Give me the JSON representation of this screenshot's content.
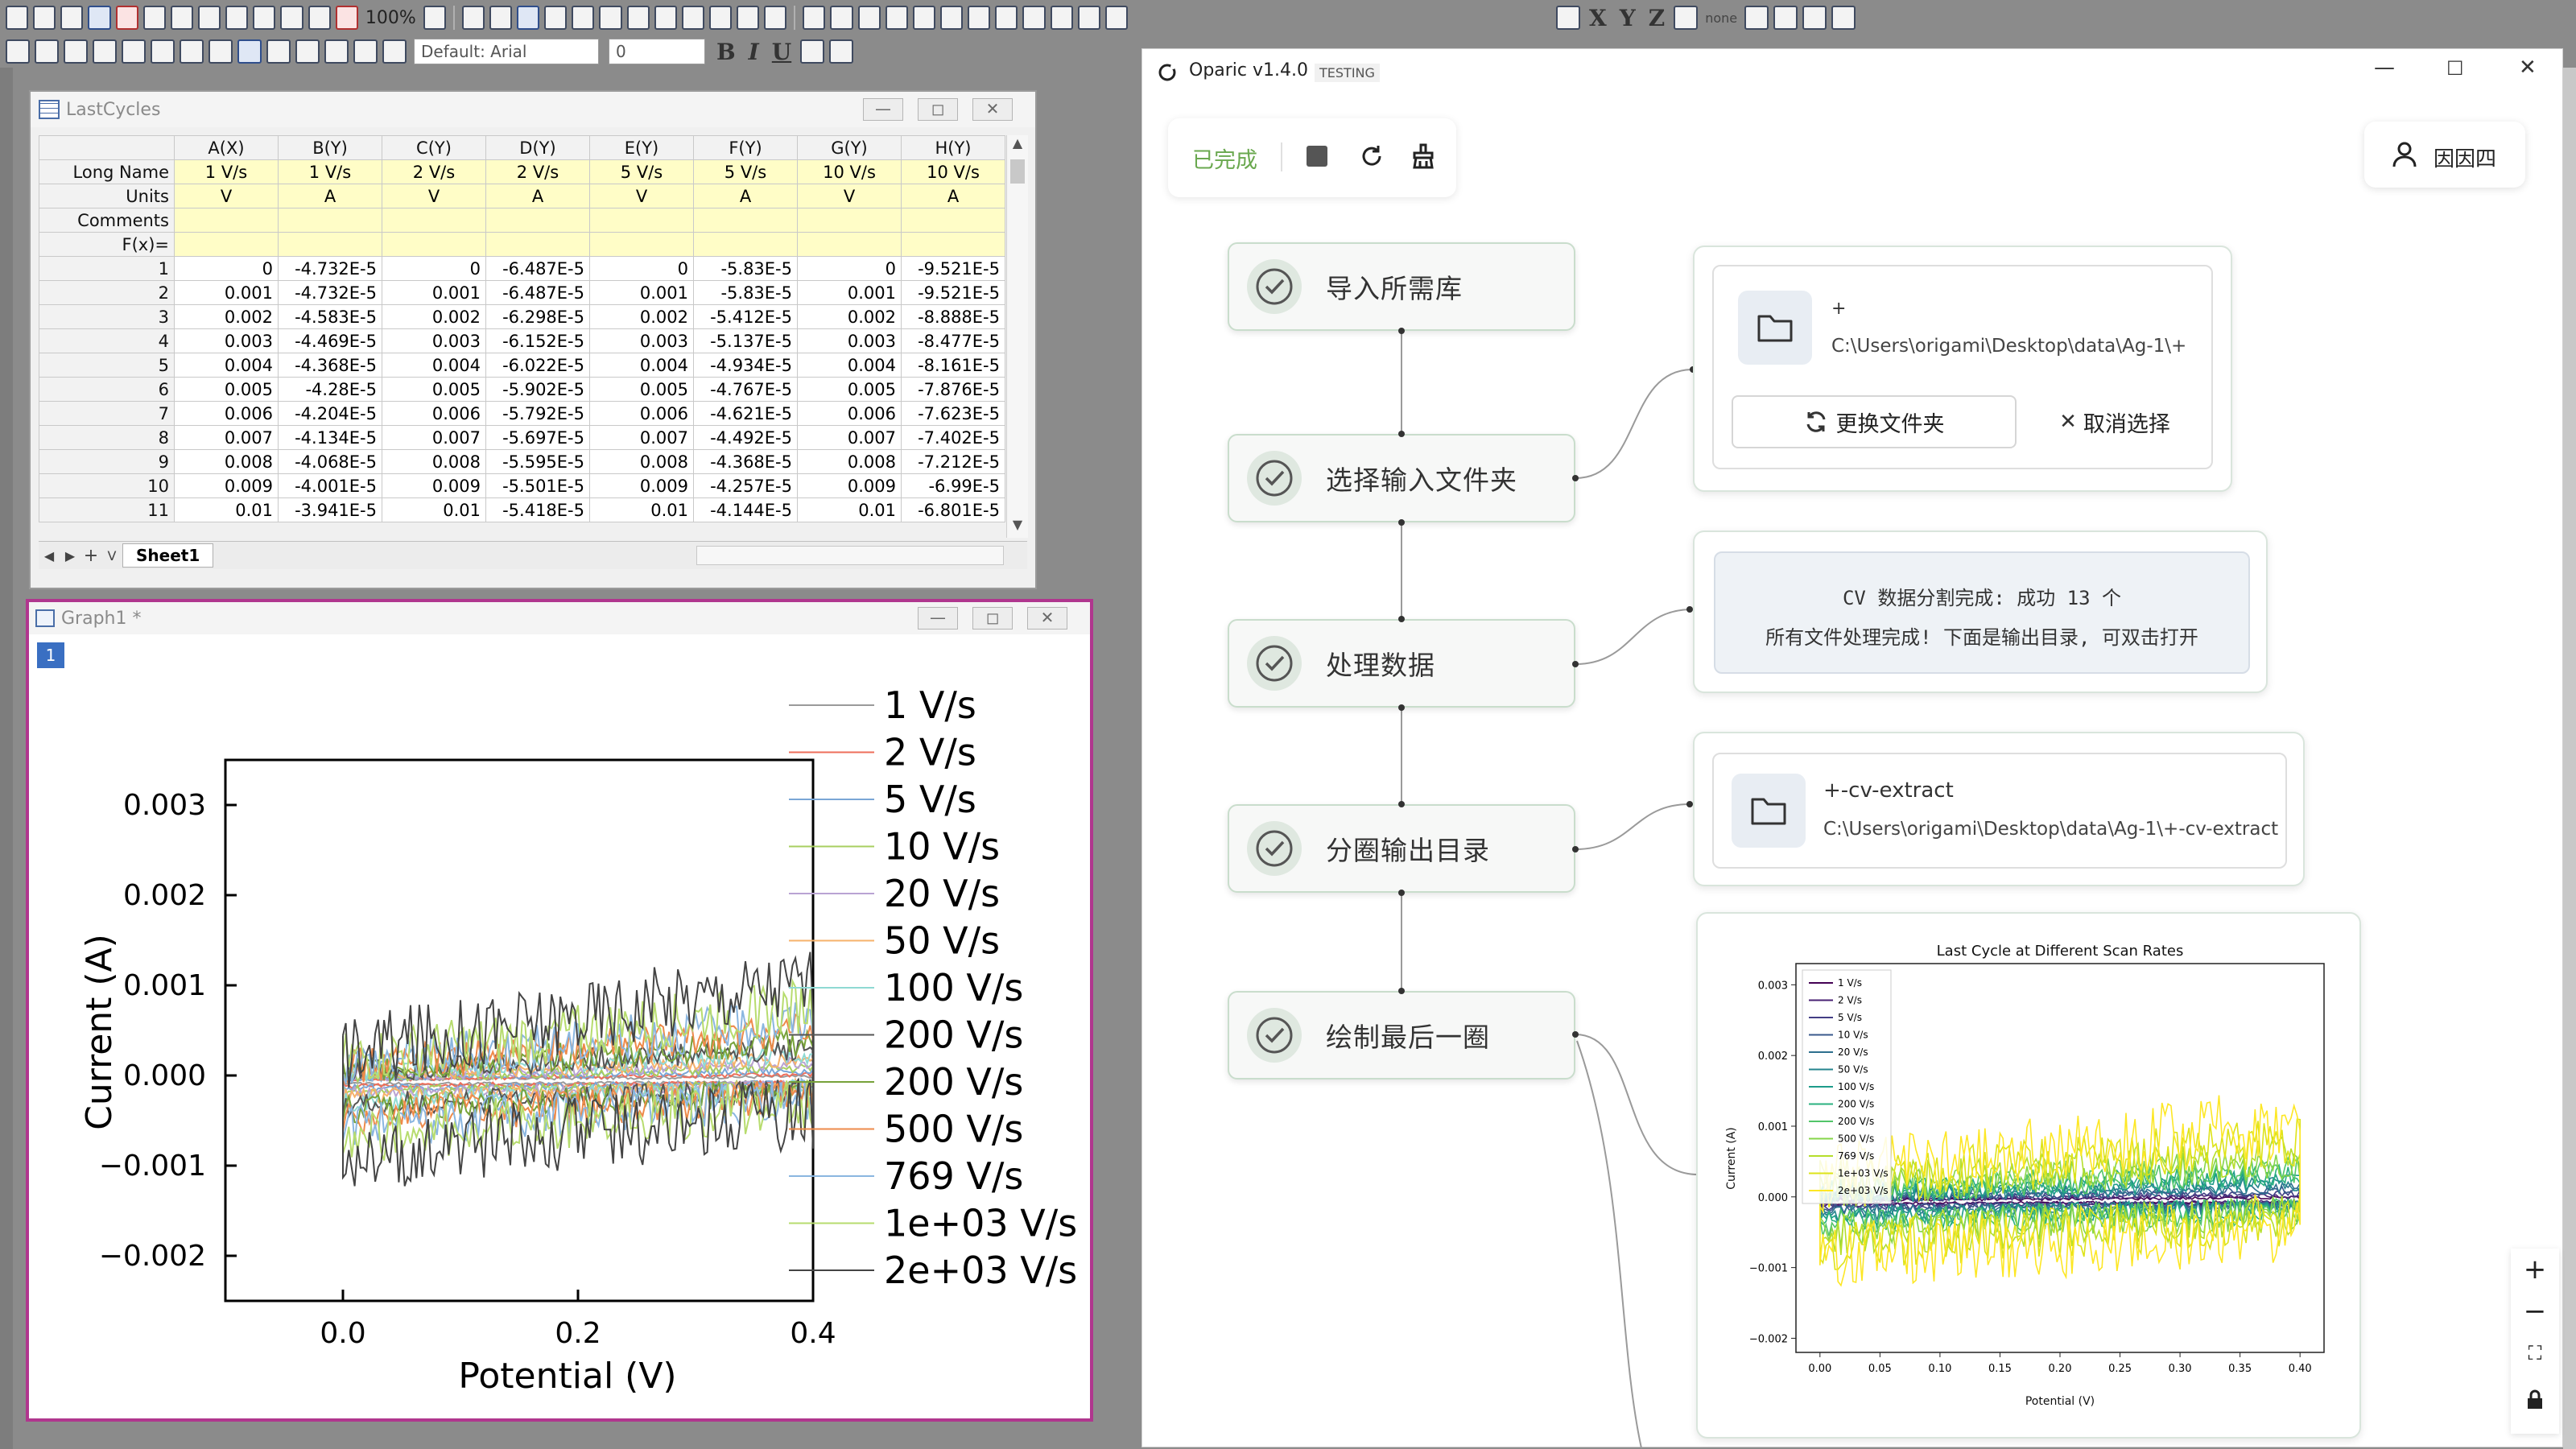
{
  "origin": {
    "zoom": "100%",
    "font_name": "Default: Arial",
    "font_size": "0",
    "format_letters": [
      "B",
      "I",
      "U"
    ],
    "axis_letters": [
      "X",
      "Y",
      "Z"
    ],
    "none_label": "none",
    "worksheet": {
      "title": "LastCycles",
      "sheet_tab": "Sheet1",
      "columns": [
        "A(X)",
        "B(Y)",
        "C(Y)",
        "D(Y)",
        "E(Y)",
        "F(Y)",
        "G(Y)",
        "H(Y)"
      ],
      "row_labels": {
        "long_name": "Long Name",
        "units": "Units",
        "comments": "Comments",
        "fx": "F(x)="
      },
      "long_names": [
        "1 V/s",
        "1 V/s",
        "2 V/s",
        "2 V/s",
        "5 V/s",
        "5 V/s",
        "10 V/s",
        "10 V/s"
      ],
      "units": [
        "V",
        "A",
        "V",
        "A",
        "V",
        "A",
        "V",
        "A"
      ],
      "rows": [
        [
          "1",
          "0",
          "-4.732E-5",
          "0",
          "-6.487E-5",
          "0",
          "-5.83E-5",
          "0",
          "-9.521E-5"
        ],
        [
          "2",
          "0.001",
          "-4.732E-5",
          "0.001",
          "-6.487E-5",
          "0.001",
          "-5.83E-5",
          "0.001",
          "-9.521E-5"
        ],
        [
          "3",
          "0.002",
          "-4.583E-5",
          "0.002",
          "-6.298E-5",
          "0.002",
          "-5.412E-5",
          "0.002",
          "-8.888E-5"
        ],
        [
          "4",
          "0.003",
          "-4.469E-5",
          "0.003",
          "-6.152E-5",
          "0.003",
          "-5.137E-5",
          "0.003",
          "-8.477E-5"
        ],
        [
          "5",
          "0.004",
          "-4.368E-5",
          "0.004",
          "-6.022E-5",
          "0.004",
          "-4.934E-5",
          "0.004",
          "-8.161E-5"
        ],
        [
          "6",
          "0.005",
          "-4.28E-5",
          "0.005",
          "-5.902E-5",
          "0.005",
          "-4.767E-5",
          "0.005",
          "-7.876E-5"
        ],
        [
          "7",
          "0.006",
          "-4.204E-5",
          "0.006",
          "-5.792E-5",
          "0.006",
          "-4.621E-5",
          "0.006",
          "-7.623E-5"
        ],
        [
          "8",
          "0.007",
          "-4.134E-5",
          "0.007",
          "-5.697E-5",
          "0.007",
          "-4.492E-5",
          "0.007",
          "-7.402E-5"
        ],
        [
          "9",
          "0.008",
          "-4.068E-5",
          "0.008",
          "-5.595E-5",
          "0.008",
          "-4.368E-5",
          "0.008",
          "-7.212E-5"
        ],
        [
          "10",
          "0.009",
          "-4.001E-5",
          "0.009",
          "-5.501E-5",
          "0.009",
          "-4.257E-5",
          "0.009",
          "-6.99E-5"
        ],
        [
          "11",
          "0.01",
          "-3.941E-5",
          "0.01",
          "-5.418E-5",
          "0.01",
          "-4.144E-5",
          "0.01",
          "-6.801E-5"
        ]
      ]
    },
    "graph": {
      "title": "Graph1 *",
      "layer_badge": "1",
      "chart_data": {
        "type": "line",
        "xlabel": "Potential (V)",
        "ylabel": "Current (A)",
        "xlim": [
          -0.1,
          0.4
        ],
        "ylim": [
          -0.0025,
          0.0035
        ],
        "x_ticks": [
          "0.0",
          "0.2",
          "0.4"
        ],
        "y_ticks": [
          "0.003",
          "0.002",
          "0.001",
          "0.000",
          "−0.001",
          "−0.002"
        ],
        "series": [
          {
            "name": "1 V/s",
            "color": "#9a9a9a",
            "half_width": 4e-05
          },
          {
            "name": "2 V/s",
            "color": "#ee6e5a",
            "half_width": 6e-05
          },
          {
            "name": "5 V/s",
            "color": "#7aa6d6",
            "half_width": 9e-05
          },
          {
            "name": "10 V/s",
            "color": "#a8cf60",
            "half_width": 0.00012
          },
          {
            "name": "20 V/s",
            "color": "#b9a3d3",
            "half_width": 0.00016
          },
          {
            "name": "50 V/s",
            "color": "#f6b26b",
            "half_width": 0.0002
          },
          {
            "name": "100 V/s",
            "color": "#8fd9d3",
            "half_width": 0.00025
          },
          {
            "name": "200 V/s",
            "color": "#555555",
            "half_width": 0.0003
          },
          {
            "name": "200 V/s",
            "color": "#77a23a",
            "half_width": 0.00035
          },
          {
            "name": "500 V/s",
            "color": "#ee8a4a",
            "half_width": 0.00045
          },
          {
            "name": "769 V/s",
            "color": "#8ab6e0",
            "half_width": 0.00055
          },
          {
            "name": "1e+03 V/s",
            "color": "#b7dc6e",
            "half_width": 0.00068
          },
          {
            "name": "2e+03 V/s",
            "color": "#444444",
            "half_width": 0.00092
          }
        ]
      }
    }
  },
  "oparic": {
    "title": "Oparic v1.4.0",
    "badge": "TESTING",
    "status": "已完成",
    "user": "因因四",
    "nodes": [
      "导入所需库",
      "选择输入文件夹",
      "处理数据",
      "分圈输出目录",
      "绘制最后一圈"
    ],
    "input_folder": {
      "name": "+",
      "path": "C:\\Users\\origami\\Desktop\\data\\Ag-1\\+",
      "change_label": "更换文件夹",
      "cancel_label": "取消选择"
    },
    "process_msg": {
      "line1": "CV 数据分割完成: 成功 13 个",
      "line2": "所有文件处理完成! 下面是输出目录, 可双击打开"
    },
    "output_folder": {
      "name": "+-cv-extract",
      "path": "C:\\Users\\origami\\Desktop\\data\\Ag-1\\+-cv-extract"
    },
    "plot": {
      "chart_data": {
        "type": "line",
        "title": "Last Cycle at Different Scan Rates",
        "xlabel": "Potential (V)",
        "ylabel": "Current (A)",
        "xlim": [
          -0.02,
          0.42
        ],
        "ylim": [
          -0.0022,
          0.0033
        ],
        "x_ticks": [
          "0.00",
          "0.05",
          "0.10",
          "0.15",
          "0.20",
          "0.25",
          "0.30",
          "0.35",
          "0.40"
        ],
        "y_ticks": [
          "0.003",
          "0.002",
          "0.001",
          "0.000",
          "−0.001",
          "−0.002"
        ],
        "legend_position": "upper-left",
        "series": [
          {
            "name": "1 V/s",
            "color": "#440154",
            "half_width": 4e-05
          },
          {
            "name": "2 V/s",
            "color": "#482173",
            "half_width": 6e-05
          },
          {
            "name": "5 V/s",
            "color": "#433e85",
            "half_width": 9e-05
          },
          {
            "name": "10 V/s",
            "color": "#38598c",
            "half_width": 0.00012
          },
          {
            "name": "20 V/s",
            "color": "#2d708e",
            "half_width": 0.00016
          },
          {
            "name": "50 V/s",
            "color": "#25858e",
            "half_width": 0.0002
          },
          {
            "name": "100 V/s",
            "color": "#1e9b8a",
            "half_width": 0.00025
          },
          {
            "name": "200 V/s",
            "color": "#2ab07f",
            "half_width": 0.0003
          },
          {
            "name": "200 V/s",
            "color": "#52c569",
            "half_width": 0.00035
          },
          {
            "name": "500 V/s",
            "color": "#86d549",
            "half_width": 0.00045
          },
          {
            "name": "769 V/s",
            "color": "#b5de2b",
            "half_width": 0.00055
          },
          {
            "name": "1e+03 V/s",
            "color": "#dde318",
            "half_width": 0.00068
          },
          {
            "name": "2e+03 V/s",
            "color": "#fde725",
            "half_width": 0.00092
          }
        ]
      }
    },
    "zoom_controls": [
      "+",
      "−"
    ]
  },
  "colors": {
    "accent_green": "#6aa84f",
    "graph_window_border": "#b0368e"
  }
}
